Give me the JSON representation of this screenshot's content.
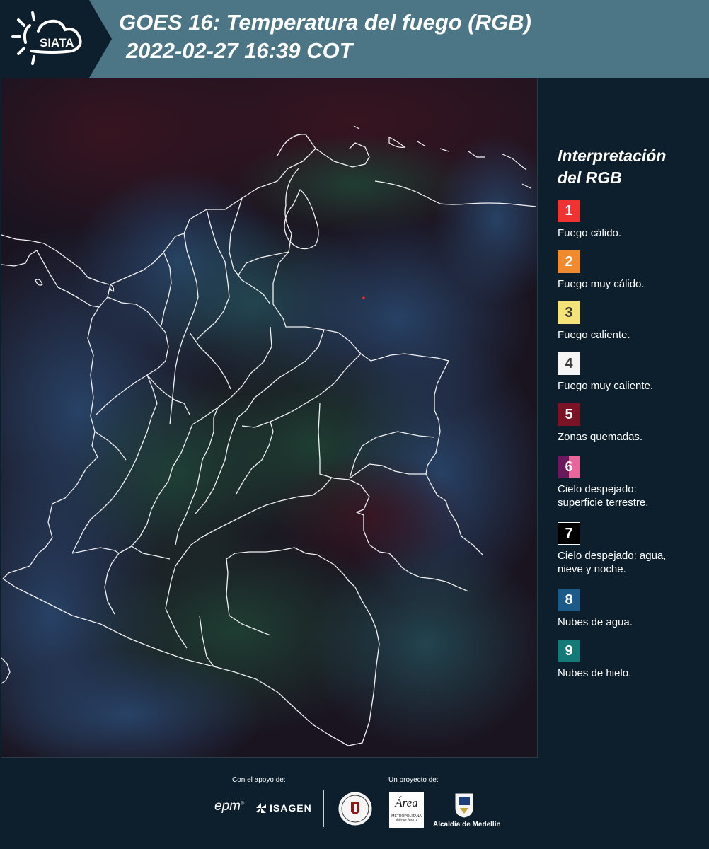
{
  "header": {
    "logo_text": "SIATA",
    "title_line1": "GOES 16: Temperatura del fuego (RGB)",
    "title_line2": "2022-02-27 16:39 COT"
  },
  "legend": {
    "title_line1": "Interpretación",
    "title_line2": "del RGB",
    "items": [
      {
        "number": "1",
        "label": "Fuego cálido.",
        "color": "#ef3232",
        "number_color": "#ffffff"
      },
      {
        "number": "2",
        "label": "Fuego muy cálido.",
        "color": "#f08a2c",
        "number_color": "#ffffff"
      },
      {
        "number": "3",
        "label": "Fuego caliente.",
        "color": "#f5e37a",
        "number_color": "#3a3a3a"
      },
      {
        "number": "4",
        "label": "Fuego muy caliente.",
        "color": "#f5f5f5",
        "number_color": "#3a3a3a"
      },
      {
        "number": "5",
        "label": "Zonas quemadas.",
        "color": "#7a1424",
        "number_color": "#ffffff"
      },
      {
        "number": "6",
        "label": "Cielo despejado: superficie terrestre.",
        "color": "#6a1a5c",
        "color_secondary": "#e8669c",
        "number_color": "#ffffff"
      },
      {
        "number": "7",
        "label": "Cielo despejado: agua, nieve y noche.",
        "color": "#000000",
        "number_color": "#ffffff"
      },
      {
        "number": "8",
        "label": "Nubes de agua.",
        "color": "#1c5a8a",
        "number_color": "#ffffff"
      },
      {
        "number": "9",
        "label": "Nubes de hielo.",
        "color": "#137a78",
        "number_color": "#ffffff"
      }
    ]
  },
  "footer": {
    "support_label": "Con el apoyo de:",
    "project_label": "Un proyecto de:",
    "epm": "epm",
    "isagen": "ISAGEN",
    "area_name": "Área",
    "area_line1": "METROPOLITANA",
    "area_line2": "Valle de Aburrá",
    "alcaldia": "Alcaldía de Medellín"
  }
}
